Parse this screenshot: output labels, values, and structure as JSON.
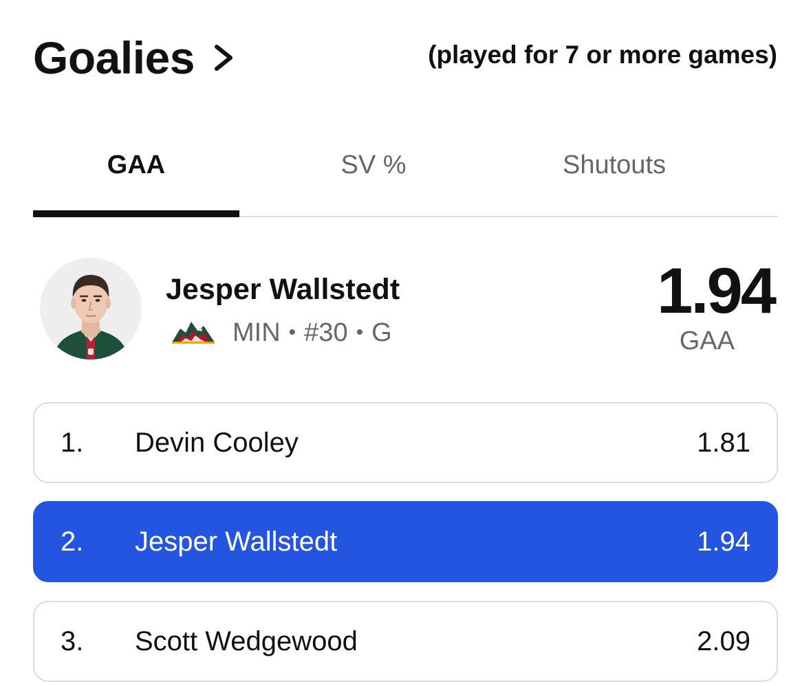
{
  "header": {
    "title": "Goalies",
    "subtitle": "(played for 7 or more games)"
  },
  "tabs": [
    {
      "label": "GAA",
      "active": true
    },
    {
      "label": "SV %",
      "active": false
    },
    {
      "label": "Shutouts",
      "active": false
    }
  ],
  "featured": {
    "name": "Jesper Wallstedt",
    "team": "MIN",
    "number": "#30",
    "position": "G",
    "separator": "•",
    "stat_value": "1.94",
    "stat_label": "GAA"
  },
  "rankings": [
    {
      "rank": "1.",
      "name": "Devin Cooley",
      "value": "1.81",
      "highlight": false
    },
    {
      "rank": "2.",
      "name": "Jesper Wallstedt",
      "value": "1.94",
      "highlight": true
    },
    {
      "rank": "3.",
      "name": "Scott Wedgewood",
      "value": "2.09",
      "highlight": false
    }
  ],
  "colors": {
    "highlight": "#2355e0",
    "text": "#111111",
    "muted": "#666666",
    "border": "#dcdcdc"
  },
  "icons": {
    "title_link": "chevron-right-icon",
    "team": "minnesota-wild-logo",
    "player": "player-headshot"
  }
}
